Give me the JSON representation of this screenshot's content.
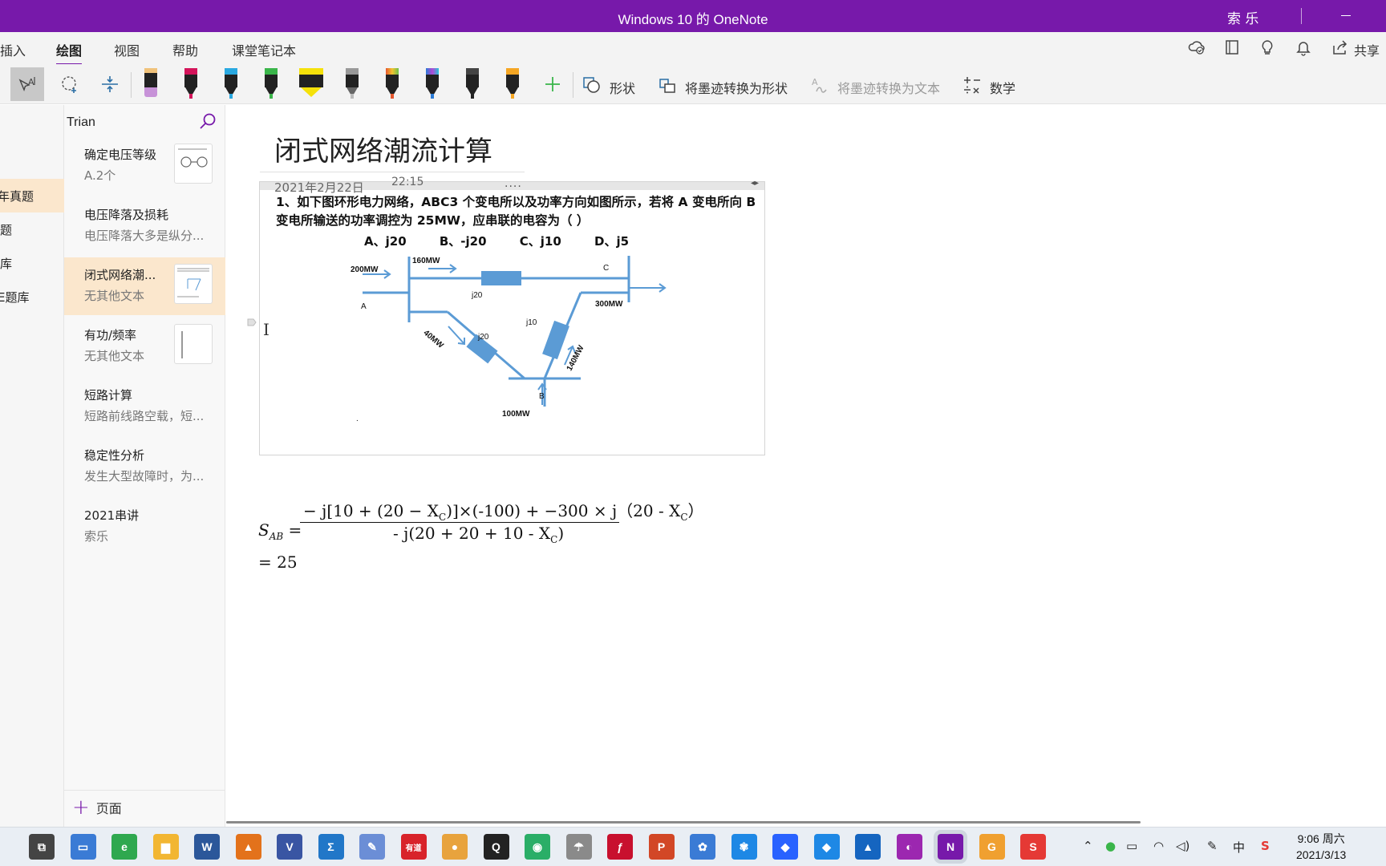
{
  "window": {
    "title": "Windows 10 的 OneNote",
    "user": "索 乐"
  },
  "ribbon": {
    "tabs": [
      {
        "label": "插入"
      },
      {
        "label": "绘图"
      },
      {
        "label": "视图"
      },
      {
        "label": "帮助"
      },
      {
        "label": "课堂笔记本"
      }
    ],
    "active_tab": "绘图",
    "share_label": "共享",
    "top_icons": [
      "sync-status-icon",
      "notebook-icon",
      "lightbulb-icon",
      "bell-icon",
      "share-icon"
    ]
  },
  "toolbar": {
    "tools": [
      "lasso-text-select-icon",
      "lasso-select-icon",
      "insert-space-icon"
    ],
    "pens": [
      {
        "name": "eraser-pen",
        "color": "#c792d8"
      },
      {
        "name": "pen-red",
        "color": "#d4145a"
      },
      {
        "name": "pen-cyan",
        "color": "#29a8e0"
      },
      {
        "name": "pen-green",
        "color": "#3ab54a"
      },
      {
        "name": "highlighter-yellow",
        "color": "#f5e10a"
      },
      {
        "name": "pencil-gray",
        "color": "#777777"
      },
      {
        "name": "pen-galaxy-red",
        "color": "#e5572e"
      },
      {
        "name": "pen-galaxy-blue",
        "color": "#2b7bd6"
      },
      {
        "name": "pen-black",
        "color": "#222222"
      },
      {
        "name": "pen-gold",
        "color": "#f5a623"
      }
    ],
    "shapes_label": "形状",
    "ink_to_shape_label": "将墨迹转换为形状",
    "ink_to_text_label": "将墨迹转换为文本",
    "math_label": "数学"
  },
  "sections": [
    {
      "label": "年真题",
      "active": true
    },
    {
      "label": "题",
      "active": false
    },
    {
      "label": "库",
      "active": false
    },
    {
      "label": "E题库",
      "active": false
    }
  ],
  "pages": {
    "search_text": "Trian",
    "items": [
      {
        "title": "确定电压等级",
        "subtitle": "A.2个",
        "thumb": true,
        "active": false
      },
      {
        "title": "电压降落及损耗",
        "subtitle": "电压降落大多是纵分...",
        "thumb": false,
        "active": false
      },
      {
        "title": "闭式网络潮...",
        "subtitle": "无其他文本",
        "thumb": true,
        "active": true
      },
      {
        "title": "有功/频率",
        "subtitle": "无其他文本",
        "thumb": true,
        "active": false
      },
      {
        "title": "短路计算",
        "subtitle": "短路前线路空载，短...",
        "thumb": false,
        "active": false
      },
      {
        "title": "稳定性分析",
        "subtitle": "发生大型故障时，为...",
        "thumb": false,
        "active": false
      },
      {
        "title": "2021串讲",
        "subtitle": "索乐",
        "thumb": false,
        "active": false
      }
    ],
    "add_page_label": "页面"
  },
  "note": {
    "title": "闭式网络潮流计算",
    "date": "2021年2月22日",
    "time": "22:15",
    "dots": "....",
    "question": "1、如下图环形电力网络，ABC3 个变电所以及功率方向如图所示，若将 A 变电所向 B 变电所输送的功率调控为 25MW，应串联的电容为（ ）",
    "options": [
      "A、j20",
      "B、-j20",
      "C、j10",
      "D、j5"
    ],
    "diagram": {
      "node_a": "A",
      "node_b": "B",
      "node_c": "C",
      "p_in_a": "200MW",
      "p_ac": "160MW",
      "p_ab": "40MW",
      "p_bc": "140MW",
      "p_out_c": "300MW",
      "p_in_b": "100MW",
      "z_ac": "j20",
      "z_ab": "j20",
      "z_bc": "j10",
      "dot": "."
    },
    "formula": {
      "lhs": "S",
      "lhs_sub": "AB",
      "eq": " =",
      "numerator": "− j[10 + (20 − X",
      "numerator_sub": "C",
      "numerator_rest": ")]×(-100) + −300 × j（20 - X",
      "numerator_sub2": "C",
      "numerator_end": "）",
      "denominator": "- j(20 + 20 + 10 - X",
      "denominator_sub": "C",
      "denominator_end": ")",
      "result": "= 25"
    }
  },
  "taskbar": {
    "apps": [
      {
        "name": "task-view-icon",
        "color": "#444444",
        "glyph": "⧉"
      },
      {
        "name": "this-pc-icon",
        "color": "#3a7bd5",
        "glyph": "▭"
      },
      {
        "name": "browser-360-icon",
        "color": "#2fa84f",
        "glyph": "e"
      },
      {
        "name": "file-explorer-icon",
        "color": "#f2b632",
        "glyph": "▆"
      },
      {
        "name": "word-icon",
        "color": "#2b579a",
        "glyph": "W"
      },
      {
        "name": "matlab-icon",
        "color": "#e3721b",
        "glyph": "▲"
      },
      {
        "name": "visio-icon",
        "color": "#3955a3",
        "glyph": "V"
      },
      {
        "name": "sigma-icon",
        "color": "#2177c8",
        "glyph": "Σ"
      },
      {
        "name": "paint-icon",
        "color": "#6b8ed6",
        "glyph": "✎"
      },
      {
        "name": "youdao-icon",
        "color": "#d8232a",
        "glyph": "有道"
      },
      {
        "name": "chrome-icon",
        "color": "#e8a33d",
        "glyph": "●"
      },
      {
        "name": "qq-icon",
        "color": "#222222",
        "glyph": "Q"
      },
      {
        "name": "wechat-icon",
        "color": "#2aae67",
        "glyph": "◉"
      },
      {
        "name": "mushroom-icon",
        "color": "#8a8a8a",
        "glyph": "☂"
      },
      {
        "name": "flash-icon",
        "color": "#c8102e",
        "glyph": "ƒ"
      },
      {
        "name": "powerpoint-icon",
        "color": "#d24726",
        "glyph": "P"
      },
      {
        "name": "netease-icon",
        "color": "#3a7bd5",
        "glyph": "✿"
      },
      {
        "name": "pinwheel-icon",
        "color": "#1e88e5",
        "glyph": "✾"
      },
      {
        "name": "feishu-icon",
        "color": "#2962ff",
        "glyph": "◆"
      },
      {
        "name": "dingtalk-icon",
        "color": "#1e88e5",
        "glyph": "◆"
      },
      {
        "name": "photos-icon",
        "color": "#1565c0",
        "glyph": "▲"
      },
      {
        "name": "colorful-icon",
        "color": "#9c27b0",
        "glyph": "◐"
      },
      {
        "name": "onenote-icon",
        "color": "#7719aa",
        "glyph": "N"
      },
      {
        "name": "g-app-icon",
        "color": "#f0a030",
        "glyph": "G"
      },
      {
        "name": "wps-icon",
        "color": "#e53935",
        "glyph": "S"
      }
    ],
    "tray": {
      "ime": "中",
      "time": "9:06 周六",
      "date": "2021/3/13"
    }
  }
}
